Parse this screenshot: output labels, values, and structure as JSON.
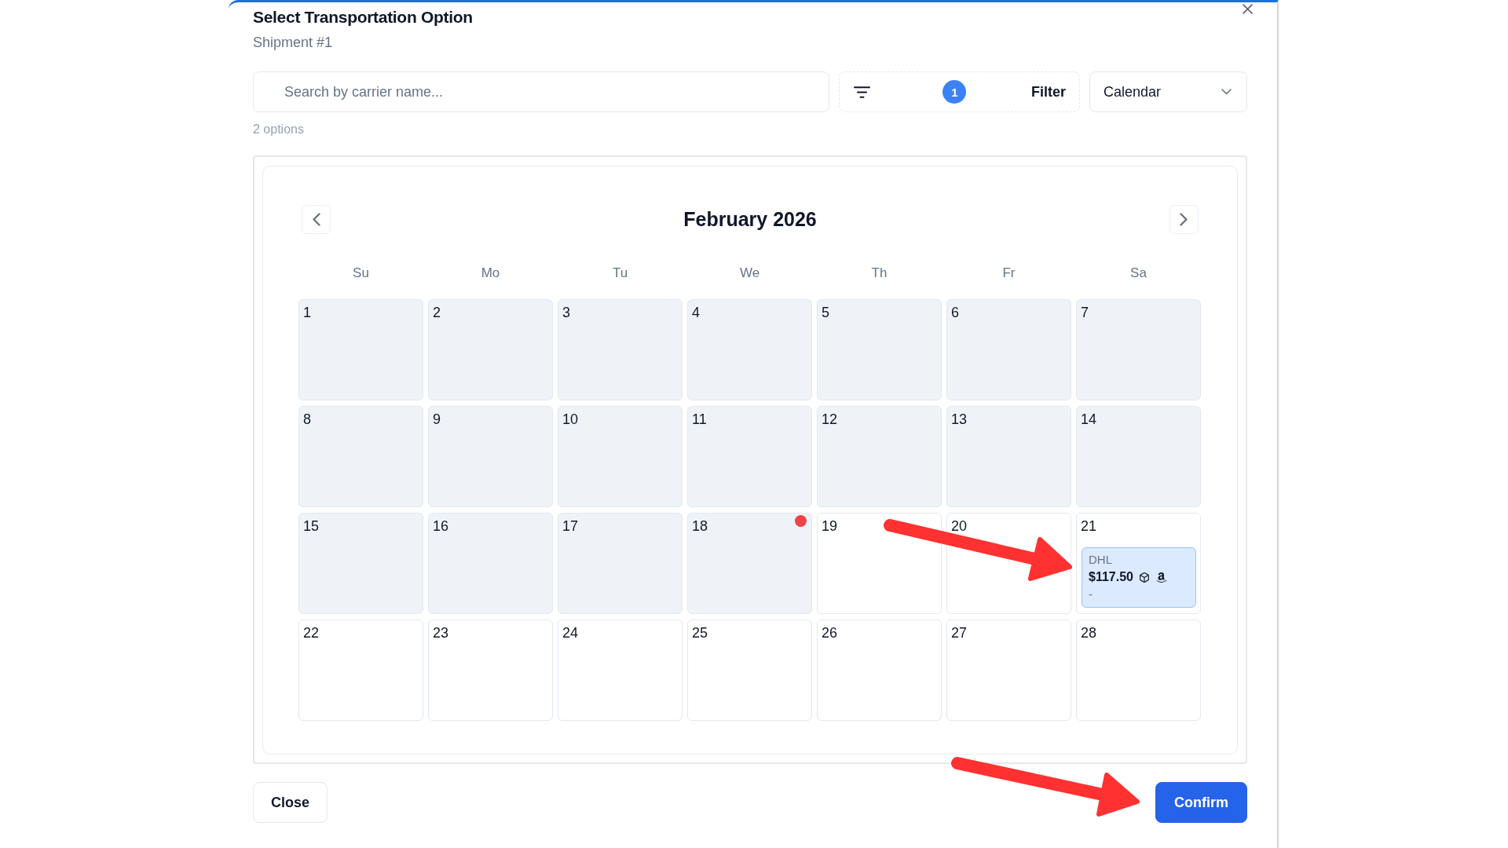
{
  "dialog": {
    "title": "Select Transportation Option",
    "subtitle": "Shipment #1"
  },
  "toolbar": {
    "search": {
      "placeholder": "Search by carrier name..."
    },
    "filter": {
      "label": "Filter",
      "badge": "1"
    },
    "view": {
      "value": "Calendar"
    }
  },
  "result_count": "2 options",
  "calendar": {
    "month": "February 2026",
    "weekdays": [
      "Su",
      "Mo",
      "Tu",
      "We",
      "Th",
      "Fr",
      "Sa"
    ],
    "weeks": [
      {
        "days": [
          {
            "day": "1",
            "disabled": true,
            "marked": false
          },
          {
            "day": "2",
            "disabled": true,
            "marked": false
          },
          {
            "day": "3",
            "disabled": true,
            "marked": false
          },
          {
            "day": "4",
            "disabled": true,
            "marked": false
          },
          {
            "day": "5",
            "disabled": true,
            "marked": false
          },
          {
            "day": "6",
            "disabled": true,
            "marked": false
          },
          {
            "day": "7",
            "disabled": true,
            "marked": false
          }
        ]
      },
      {
        "days": [
          {
            "day": "8",
            "disabled": true,
            "marked": false
          },
          {
            "day": "9",
            "disabled": true,
            "marked": false
          },
          {
            "day": "10",
            "disabled": true,
            "marked": false
          },
          {
            "day": "11",
            "disabled": true,
            "marked": false
          },
          {
            "day": "12",
            "disabled": true,
            "marked": false
          },
          {
            "day": "13",
            "disabled": true,
            "marked": false
          },
          {
            "day": "14",
            "disabled": true,
            "marked": false
          }
        ]
      },
      {
        "days": [
          {
            "day": "15",
            "disabled": true,
            "marked": false
          },
          {
            "day": "16",
            "disabled": true,
            "marked": false
          },
          {
            "day": "17",
            "disabled": true,
            "marked": false
          },
          {
            "day": "18",
            "disabled": true,
            "marked": true
          },
          {
            "day": "19",
            "disabled": false,
            "marked": false
          },
          {
            "day": "20",
            "disabled": false,
            "marked": false
          },
          {
            "day": "21",
            "disabled": false,
            "marked": false,
            "options": [
              {
                "carrier": "DHL",
                "price": "$117.50",
                "note": "-"
              }
            ]
          }
        ]
      },
      {
        "days": [
          {
            "day": "22",
            "disabled": false,
            "marked": false
          },
          {
            "day": "23",
            "disabled": false,
            "marked": false
          },
          {
            "day": "24",
            "disabled": false,
            "marked": false
          },
          {
            "day": "25",
            "disabled": false,
            "marked": false
          },
          {
            "day": "26",
            "disabled": false,
            "marked": false
          },
          {
            "day": "27",
            "disabled": false,
            "marked": false
          },
          {
            "day": "28",
            "disabled": false,
            "marked": false
          }
        ]
      }
    ]
  },
  "buttons": [
    {
      "label": "Close",
      "kind": "secondary"
    },
    {
      "label": "Confirm",
      "kind": "primary"
    }
  ]
}
